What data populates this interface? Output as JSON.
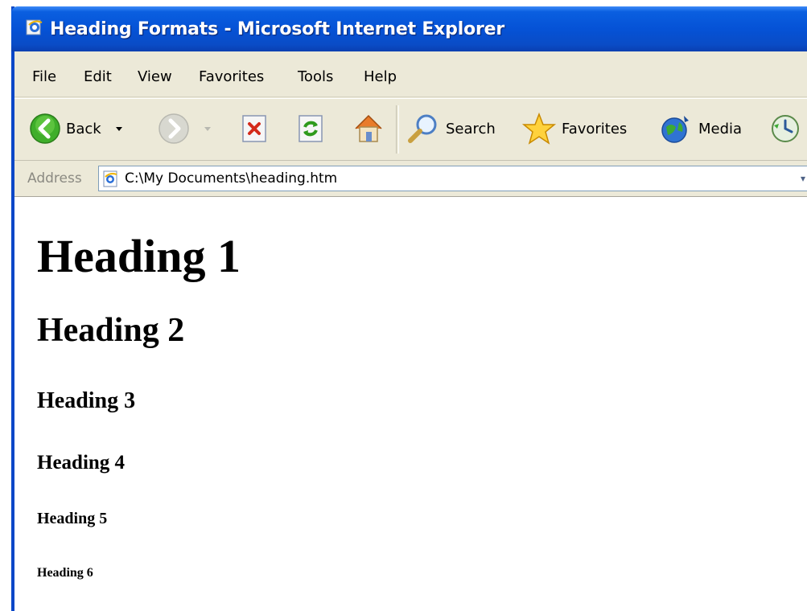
{
  "window": {
    "title": "Heading Formats - Microsoft Internet Explorer"
  },
  "menu": {
    "items": [
      "File",
      "Edit",
      "View",
      "Favorites",
      "Tools",
      "Help"
    ]
  },
  "toolbar": {
    "back_label": "Back",
    "search_label": "Search",
    "favorites_label": "Favorites",
    "media_label": "Media"
  },
  "address": {
    "label": "Address",
    "value": "C:\\My Documents\\heading.htm"
  },
  "content": {
    "headings": [
      "Heading 1",
      "Heading 2",
      "Heading 3",
      "Heading 4",
      "Heading 5",
      "Heading 6"
    ]
  },
  "colors": {
    "title_bar": "#0552d6",
    "chrome": "#ece9d8",
    "page_background": "#ffffff"
  }
}
